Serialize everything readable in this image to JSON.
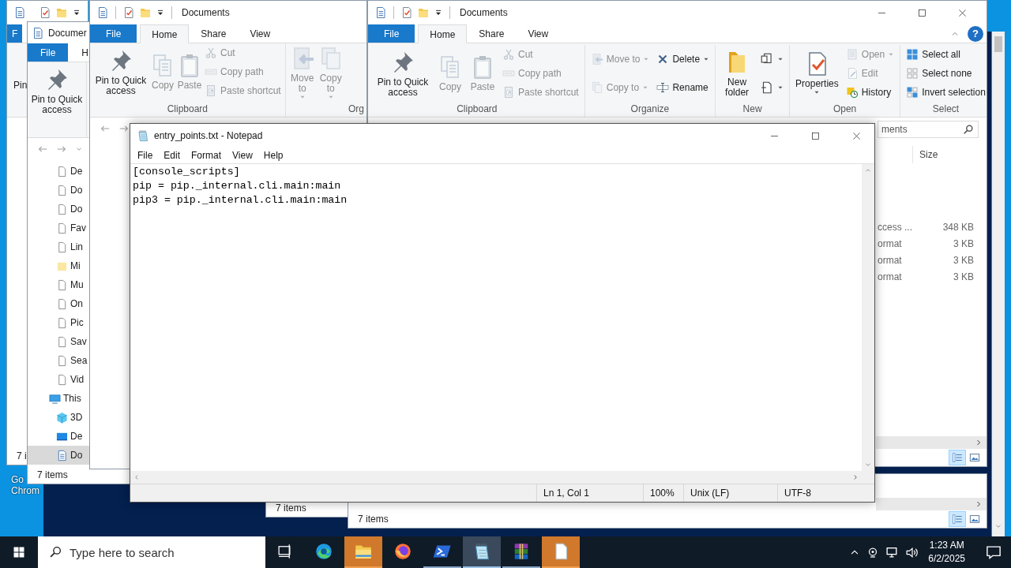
{
  "desktop_icon": {
    "lines": [
      "Go",
      "Chrom"
    ]
  },
  "windows": [
    {
      "kind": "explorer",
      "tabs": [
        {
          "label": "F",
          "kind": "file",
          "selected": false
        }
      ],
      "ribbon_fragment": "Pin",
      "status": "7 i"
    },
    {
      "kind": "explorer",
      "title": "Documer",
      "tabs": [
        {
          "label": "File",
          "kind": "file",
          "selected": false
        },
        {
          "label": "H",
          "kind": "tab",
          "selected": false
        }
      ],
      "ribbon": {
        "groups": [
          {
            "columns": [
              [
                {
                  "label": "Pin to Quick access",
                  "kind": "large",
                  "disabled": false,
                  "dropdown": false
                }
              ]
            ]
          }
        ]
      },
      "nav": {
        "items": [
          {
            "label": "De",
            "kind": "file",
            "selected": false
          },
          {
            "label": "Do",
            "kind": "file",
            "selected": false
          },
          {
            "label": "Do",
            "kind": "file",
            "selected": false
          },
          {
            "label": "Fav",
            "kind": "file",
            "selected": false
          },
          {
            "label": "Lin",
            "kind": "file",
            "selected": false
          },
          {
            "label": "Mi",
            "kind": "folder",
            "selected": false
          },
          {
            "label": "Mu",
            "kind": "file",
            "selected": false
          },
          {
            "label": "On",
            "kind": "file",
            "selected": false
          },
          {
            "label": "Pic",
            "kind": "file",
            "selected": false
          },
          {
            "label": "Sav",
            "kind": "file",
            "selected": false
          },
          {
            "label": "Sea",
            "kind": "file",
            "selected": false
          },
          {
            "label": "Vid",
            "kind": "file",
            "selected": false
          }
        ],
        "this_pc": {
          "label": "This",
          "kind": "pc",
          "selected": false,
          "children": [
            {
              "label": "3D",
              "kind": "cube",
              "selected": false
            },
            {
              "label": "De",
              "kind": "desktop",
              "selected": false
            },
            {
              "label": "Do",
              "kind": "doc",
              "selected": true
            }
          ]
        }
      },
      "status": "7 items"
    },
    {
      "kind": "explorer",
      "title": "Documents",
      "tabs": [
        {
          "label": "File",
          "kind": "file",
          "selected": false
        },
        {
          "label": "Home",
          "kind": "tab",
          "selected": true
        },
        {
          "label": "Share",
          "kind": "tab",
          "selected": false
        },
        {
          "label": "View",
          "kind": "tab",
          "selected": false
        }
      ],
      "ribbon": {
        "groups": [
          {
            "label": "Clipboard",
            "columns": [
              [
                {
                  "label": "Pin to Quick access",
                  "kind": "large",
                  "disabled": false,
                  "dropdown": false
                }
              ],
              [
                {
                  "label": "Copy",
                  "kind": "large",
                  "disabled": true,
                  "dropdown": false
                }
              ],
              [
                {
                  "label": "Paste",
                  "kind": "large",
                  "disabled": true,
                  "dropdown": false
                }
              ],
              [
                {
                  "label": "Cut",
                  "kind": "small",
                  "disabled": true,
                  "dropdown": false
                },
                {
                  "label": "Copy path",
                  "kind": "small",
                  "disabled": true,
                  "dropdown": false
                },
                {
                  "label": "Paste shortcut",
                  "kind": "small",
                  "disabled": true,
                  "dropdown": false
                }
              ]
            ]
          },
          {
            "label": "Org",
            "columns": [
              [
                {
                  "label": "Move to",
                  "kind": "large",
                  "disabled": true,
                  "dropdown": true
                }
              ],
              [
                {
                  "label": "Copy to",
                  "kind": "large",
                  "disabled": true,
                  "dropdown": true
                }
              ]
            ]
          }
        ]
      }
    },
    {
      "kind": "explorer",
      "status": "7 items"
    },
    {
      "kind": "explorer",
      "status": "7 items",
      "view_buttons": [
        {
          "selected": true
        },
        {
          "selected": false
        }
      ]
    },
    {
      "kind": "explorer",
      "title": "Documents",
      "controls": true,
      "tabs": [
        {
          "label": "File",
          "kind": "file",
          "selected": false
        },
        {
          "label": "Home",
          "kind": "tab",
          "selected": true
        },
        {
          "label": "Share",
          "kind": "tab",
          "selected": false
        },
        {
          "label": "View",
          "kind": "tab",
          "selected": false
        }
      ],
      "help_button": "?",
      "ribbon": {
        "groups": [
          {
            "label": "Clipboard",
            "columns": [
              [
                {
                  "label": "Pin to Quick access",
                  "kind": "large",
                  "disabled": false,
                  "dropdown": false
                }
              ],
              [
                {
                  "label": "Copy",
                  "kind": "large",
                  "disabled": true,
                  "dropdown": false
                }
              ],
              [
                {
                  "label": "Paste",
                  "kind": "large",
                  "disabled": true,
                  "dropdown": false
                }
              ],
              [
                {
                  "label": "Cut",
                  "kind": "small",
                  "disabled": true,
                  "dropdown": false
                },
                {
                  "label": "Copy path",
                  "kind": "small",
                  "disabled": true,
                  "dropdown": false
                },
                {
                  "label": "Paste shortcut",
                  "kind": "small",
                  "disabled": true,
                  "dropdown": false
                }
              ]
            ]
          },
          {
            "label": "Organize",
            "columns": [
              [
                {
                  "label": "Move to",
                  "kind": "small",
                  "disabled": true,
                  "dropdown": true
                },
                {
                  "label": "Copy to",
                  "kind": "small",
                  "disabled": true,
                  "dropdown": true
                }
              ],
              [
                {
                  "label": "Delete",
                  "kind": "small",
                  "disabled": false,
                  "dropdown": true
                },
                {
                  "label": "Rename",
                  "kind": "small",
                  "disabled": false,
                  "dropdown": false
                }
              ]
            ]
          },
          {
            "label": "New",
            "columns": [
              [
                {
                  "label": "New folder",
                  "kind": "large",
                  "disabled": false,
                  "dropdown": false
                }
              ],
              [
                {
                  "kind": "icon",
                  "disabled": false,
                  "dropdown": true
                },
                {
                  "kind": "icon",
                  "disabled": false,
                  "dropdown": true
                }
              ]
            ]
          },
          {
            "label": "Open",
            "columns": [
              [
                {
                  "label": "Properties",
                  "kind": "large",
                  "disabled": false,
                  "dropdown": true
                }
              ],
              [
                {
                  "label": "Open",
                  "kind": "small",
                  "disabled": true,
                  "dropdown": true
                },
                {
                  "label": "Edit",
                  "kind": "small",
                  "disabled": true,
                  "dropdown": false
                },
                {
                  "label": "History",
                  "kind": "small",
                  "disabled": false,
                  "dropdown": false
                }
              ]
            ]
          },
          {
            "label": "Select",
            "columns": [
              [
                {
                  "label": "Select all",
                  "kind": "small",
                  "disabled": false,
                  "dropdown": false
                },
                {
                  "label": "Select none",
                  "kind": "small",
                  "disabled": false,
                  "dropdown": false
                },
                {
                  "label": "Invert selection",
                  "kind": "small",
                  "disabled": false,
                  "dropdown": false
                }
              ]
            ]
          }
        ]
      },
      "search": {
        "placeholder": "ments"
      },
      "columns": [
        {
          "label": "Size"
        }
      ],
      "rows": [
        {
          "column_1": "ccess ...",
          "size": "348 KB"
        },
        {
          "column_1": "ormat",
          "size": "3 KB"
        },
        {
          "column_1": "ormat",
          "size": "3 KB"
        },
        {
          "column_1": "ormat",
          "size": "3 KB"
        }
      ],
      "view_buttons": [
        {
          "selected": true
        },
        {
          "selected": false
        }
      ]
    },
    {
      "kind": "notepad",
      "title": "entry_points.txt - Notepad",
      "menu": [
        "File",
        "Edit",
        "Format",
        "View",
        "Help"
      ],
      "lines": [
        "[console_scripts]",
        "pip = pip._internal.cli.main:main",
        "pip3 = pip._internal.cli.main:main"
      ],
      "status": [
        "Ln 1, Col 1",
        "100%",
        "Unix (LF)",
        "UTF-8"
      ]
    }
  ],
  "taskbar": {
    "search": {
      "placeholder": "Type here to search"
    },
    "apps": [
      {
        "running": false,
        "active": false,
        "flashing": false
      },
      {
        "running": true,
        "active": false,
        "flashing": true
      },
      {
        "running": false,
        "active": false,
        "flashing": false
      },
      {
        "running": true,
        "active": false,
        "flashing": false
      },
      {
        "running": true,
        "active": true,
        "flashing": false
      },
      {
        "running": true,
        "active": false,
        "flashing": false
      },
      {
        "running": true,
        "active": false,
        "flashing": true
      }
    ],
    "clock": {
      "time": "1:23 AM",
      "date": "6/2/2025"
    }
  }
}
